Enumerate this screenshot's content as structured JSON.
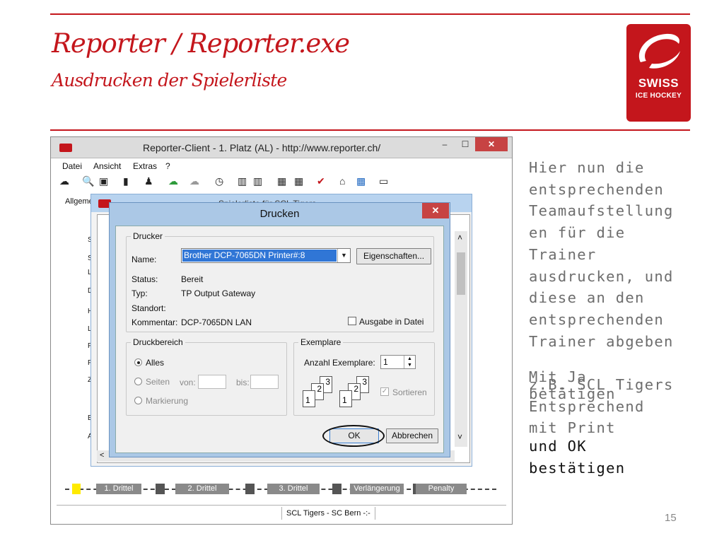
{
  "slide": {
    "title": "Reporter / Reporter.exe",
    "subtitle": "Ausdrucken der Spielerliste",
    "page_number": "15",
    "logo": {
      "line1": "SWISS",
      "line2": "ICE HOCKEY"
    },
    "side_text_gray": "Hier nun die\nentsprechenden\nTeamaufstellung\nen für die\nTrainer\nausdrucken, und\ndiese an den\nentsprechenden\nTrainer abgeben",
    "overlap_a": "Mit Ja\nbetätigen",
    "overlap_b": "z.B. SCL Tigers\nEntsprechend\nmit Print",
    "side_text_black": "und OK\nbestätigen",
    "colors": {
      "brand_red": "#c4161c"
    }
  },
  "app": {
    "title": "Reporter-Client  -  1. Platz (AL)  -  http://www.reporter.ch/",
    "win_min": "–",
    "win_max": "☐",
    "win_close": "✕",
    "menu": [
      "Datei",
      "Ansicht",
      "Extras",
      "?"
    ],
    "tab_label": "Allgeme",
    "inner_title_partial": "Spielerliste für SCL Tigers",
    "periods": [
      "1. Drittel",
      "2. Drittel",
      "3. Drittel",
      "Verlängerung",
      "Penalty"
    ],
    "status_match": "SCL Tigers - SC Bern -:-",
    "left_letters": [
      "S",
      "S",
      "L",
      "D",
      "H",
      "L",
      "P",
      "P",
      "Z",
      "B",
      "A"
    ],
    "scroll_left_arrow": "<",
    "scroll_down_arrow": "˅",
    "scroll_up_arrow": "˄"
  },
  "dialog": {
    "title": "Drucken",
    "close": "✕",
    "printer_group": "Drucker",
    "name_label": "Name:",
    "printer_name": "Brother DCP-7065DN Printer#:8",
    "properties_button": "Eigenschaften...",
    "status_label": "Status:",
    "status_value": "Bereit",
    "type_label": "Typ:",
    "type_value": "TP Output Gateway",
    "location_label": "Standort:",
    "comment_label": "Kommentar:",
    "comment_value": "DCP-7065DN LAN",
    "print_to_file": "Ausgabe in Datei",
    "range_group": "Druckbereich",
    "range_all": "Alles",
    "range_pages": "Seiten",
    "range_from": "von:",
    "range_to": "bis:",
    "range_selection": "Markierung",
    "copies_group": "Exemplare",
    "copies_label": "Anzahl Exemplare:",
    "copies_value": "1",
    "collate": "Sortieren",
    "ok": "OK",
    "cancel": "Abbrechen"
  }
}
